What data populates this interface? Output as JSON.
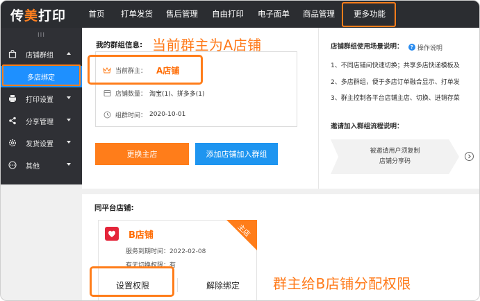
{
  "brand": {
    "logo_part1": "传",
    "logo_part2": "美",
    "logo_part3": "打印"
  },
  "nav": {
    "items": [
      "首页",
      "打单发货",
      "售后管理",
      "自由打印",
      "电子面单",
      "商品管理",
      "更多功能"
    ]
  },
  "sidebar": {
    "grip": "III",
    "items": [
      {
        "label": "店铺群组",
        "icon": "bag-icon"
      },
      {
        "label": "打印设置",
        "icon": "printer-icon"
      },
      {
        "label": "分享管理",
        "icon": "share-icon"
      },
      {
        "label": "发货设置",
        "icon": "gear-icon"
      },
      {
        "label": "其他",
        "icon": "more-icon"
      }
    ],
    "sub_item": "多店绑定"
  },
  "group": {
    "title": "我的群组信息:",
    "annotation": "当前群主为A店铺",
    "owner_label": "当前群主：",
    "owner_value": "A店铺",
    "count_label": "店铺数量：",
    "count_value": "淘宝(1)、拼多多(1)",
    "time_label": "组群时间：",
    "time_value": "2020-10-01",
    "btn_change": "更换主店",
    "btn_add": "添加店铺加入群组"
  },
  "usage": {
    "title": "店铺群组使用场景说明：",
    "help": "操作说明",
    "lines": [
      "1、不同店铺间快速切换；共享多店快递模板及",
      "2、多店群组，便于多店订单融合显示、打单发",
      "3、群主控制各平台店铺主店、切换、进销存菜"
    ],
    "flow_title": "邀请加入群组流程说明：",
    "flow_step_line1": "被邀请用户须复制",
    "flow_step_line2": "店铺分享码"
  },
  "same_platform": {
    "title": "同平台店铺:",
    "store_name": "B店铺",
    "ribbon": "主店",
    "expire_label": "服务到期时间：",
    "expire_value": "2022-02-08",
    "switch_line": "有无切换权限：有",
    "btn_set": "设置权限",
    "btn_unbind": "解除绑定",
    "annotation": "群主给B店铺分配权限"
  },
  "colors": {
    "accent": "#ff7d1a",
    "blue": "#1e95f0",
    "nav_bg": "#2b2d31",
    "sidebar_bg": "#2f3035"
  }
}
